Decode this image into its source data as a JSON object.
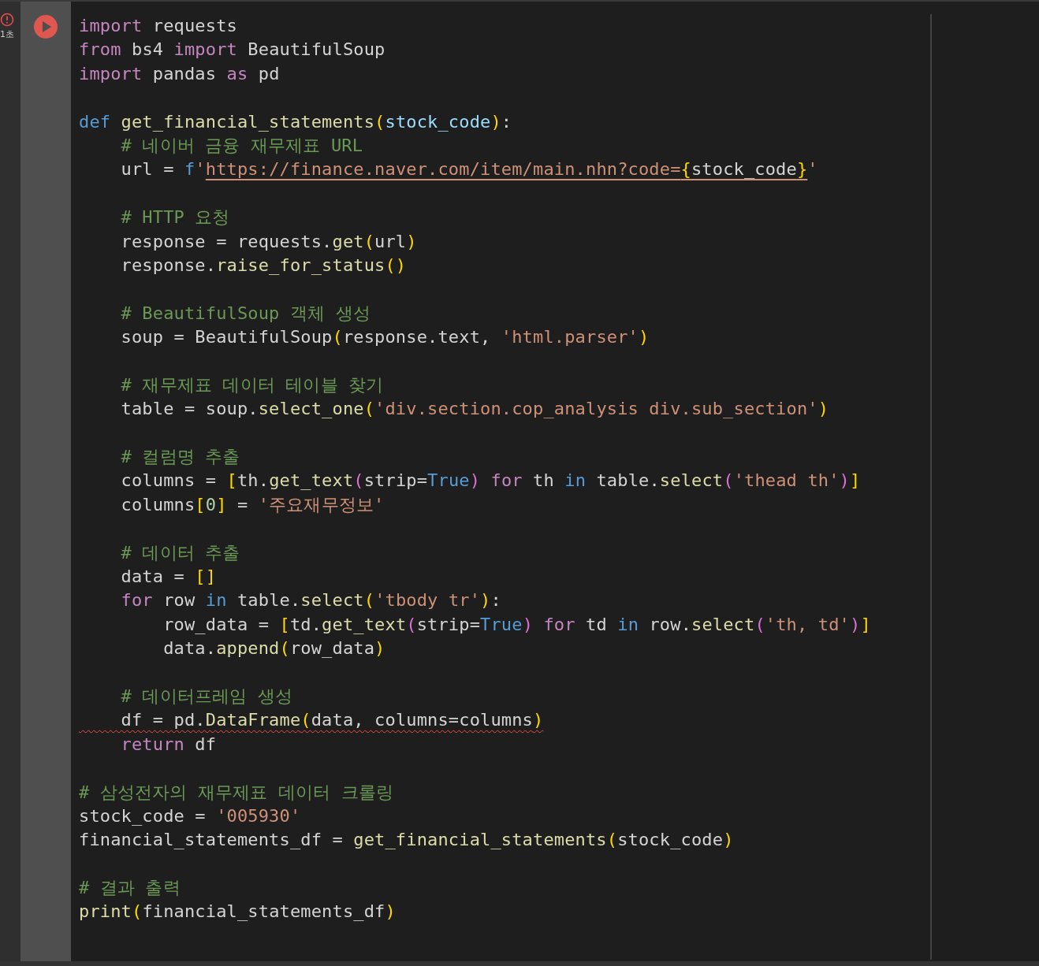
{
  "cell": {
    "status": {
      "text": "1초",
      "error": true
    },
    "run_button": {
      "failed": true
    },
    "lines": [
      {
        "kind": "code",
        "error": false,
        "tokens": [
          {
            "t": "import",
            "kind": "kw"
          },
          {
            "t": " requests",
            "kind": "plain"
          }
        ]
      },
      {
        "kind": "code",
        "error": false,
        "tokens": [
          {
            "t": "from",
            "kind": "kw"
          },
          {
            "t": " bs4 ",
            "kind": "plain"
          },
          {
            "t": "import",
            "kind": "kw"
          },
          {
            "t": " BeautifulSoup",
            "kind": "plain"
          }
        ]
      },
      {
        "kind": "code",
        "error": false,
        "tokens": [
          {
            "t": "import",
            "kind": "kw"
          },
          {
            "t": " pandas ",
            "kind": "plain"
          },
          {
            "t": "as",
            "kind": "kw"
          },
          {
            "t": " pd",
            "kind": "plain"
          }
        ]
      },
      {
        "kind": "blank"
      },
      {
        "kind": "code",
        "error": false,
        "tokens": [
          {
            "t": "def",
            "kind": "storage"
          },
          {
            "t": " get_financial_statements",
            "kind": "fn"
          },
          {
            "t": "(",
            "kind": "b1"
          },
          {
            "t": "stock_code",
            "kind": "param"
          },
          {
            "t": ")",
            "kind": "b1"
          },
          {
            "t": ":",
            "kind": "plain"
          }
        ]
      },
      {
        "kind": "code",
        "error": false,
        "tokens": [
          {
            "t": "    # 네이버 금융 재무제표 URL",
            "kind": "cmt"
          }
        ]
      },
      {
        "kind": "code",
        "error": false,
        "tokens": [
          {
            "t": "    url = ",
            "kind": "plain",
            "underlined": false
          },
          {
            "t": "f",
            "kind": "storage",
            "underlined": false
          },
          {
            "t": "'",
            "kind": "str",
            "underlined": false
          },
          {
            "t": "https://finance.naver.com/item/main.nhn?code=",
            "kind": "str",
            "underlined": true
          },
          {
            "t": "{",
            "kind": "b1",
            "underlined": true
          },
          {
            "t": "stock_code",
            "kind": "plain",
            "underlined": true
          },
          {
            "t": "}",
            "kind": "b1",
            "underlined": true
          },
          {
            "t": "'",
            "kind": "str",
            "underlined": false
          }
        ]
      },
      {
        "kind": "blank"
      },
      {
        "kind": "code",
        "error": false,
        "tokens": [
          {
            "t": "    # HTTP 요청",
            "kind": "cmt"
          }
        ]
      },
      {
        "kind": "code",
        "error": false,
        "tokens": [
          {
            "t": "    response = requests.",
            "kind": "plain"
          },
          {
            "t": "get",
            "kind": "fn"
          },
          {
            "t": "(",
            "kind": "b1"
          },
          {
            "t": "url",
            "kind": "plain"
          },
          {
            "t": ")",
            "kind": "b1"
          }
        ]
      },
      {
        "kind": "code",
        "error": false,
        "tokens": [
          {
            "t": "    response.",
            "kind": "plain"
          },
          {
            "t": "raise_for_status",
            "kind": "fn"
          },
          {
            "t": "()",
            "kind": "b1"
          }
        ]
      },
      {
        "kind": "blank"
      },
      {
        "kind": "code",
        "error": false,
        "tokens": [
          {
            "t": "    # BeautifulSoup 객체 생성",
            "kind": "cmt"
          }
        ]
      },
      {
        "kind": "code",
        "error": false,
        "tokens": [
          {
            "t": "    soup = BeautifulSoup",
            "kind": "plain"
          },
          {
            "t": "(",
            "kind": "b1"
          },
          {
            "t": "response.text, ",
            "kind": "plain"
          },
          {
            "t": "'html.parser'",
            "kind": "str"
          },
          {
            "t": ")",
            "kind": "b1"
          }
        ]
      },
      {
        "kind": "blank"
      },
      {
        "kind": "code",
        "error": false,
        "tokens": [
          {
            "t": "    # 재무제표 데이터 테이블 찾기",
            "kind": "cmt"
          }
        ]
      },
      {
        "kind": "code",
        "error": false,
        "tokens": [
          {
            "t": "    table = soup.",
            "kind": "plain"
          },
          {
            "t": "select_one",
            "kind": "fn"
          },
          {
            "t": "(",
            "kind": "b1"
          },
          {
            "t": "'div.section.cop_analysis div.sub_section'",
            "kind": "str"
          },
          {
            "t": ")",
            "kind": "b1"
          }
        ]
      },
      {
        "kind": "blank"
      },
      {
        "kind": "code",
        "error": false,
        "tokens": [
          {
            "t": "    # 컬럼명 추출",
            "kind": "cmt"
          }
        ]
      },
      {
        "kind": "code",
        "error": false,
        "tokens": [
          {
            "t": "    columns = ",
            "kind": "plain"
          },
          {
            "t": "[",
            "kind": "b1"
          },
          {
            "t": "th.",
            "kind": "plain"
          },
          {
            "t": "get_text",
            "kind": "fn"
          },
          {
            "t": "(",
            "kind": "b2"
          },
          {
            "t": "strip=",
            "kind": "plain"
          },
          {
            "t": "True",
            "kind": "const"
          },
          {
            "t": ")",
            "kind": "b2"
          },
          {
            "t": " for",
            "kind": "kw"
          },
          {
            "t": " th ",
            "kind": "plain"
          },
          {
            "t": "in",
            "kind": "op"
          },
          {
            "t": " table.",
            "kind": "plain"
          },
          {
            "t": "select",
            "kind": "fn"
          },
          {
            "t": "(",
            "kind": "b2"
          },
          {
            "t": "'thead th'",
            "kind": "str"
          },
          {
            "t": ")",
            "kind": "b2"
          },
          {
            "t": "]",
            "kind": "b1"
          }
        ]
      },
      {
        "kind": "code",
        "error": false,
        "tokens": [
          {
            "t": "    columns",
            "kind": "plain"
          },
          {
            "t": "[",
            "kind": "b1"
          },
          {
            "t": "0",
            "kind": "num"
          },
          {
            "t": "]",
            "kind": "b1"
          },
          {
            "t": " = ",
            "kind": "plain"
          },
          {
            "t": "'주요재무정보'",
            "kind": "str"
          }
        ]
      },
      {
        "kind": "blank"
      },
      {
        "kind": "code",
        "error": false,
        "tokens": [
          {
            "t": "    # 데이터 추출",
            "kind": "cmt"
          }
        ]
      },
      {
        "kind": "code",
        "error": false,
        "tokens": [
          {
            "t": "    data = ",
            "kind": "plain"
          },
          {
            "t": "[]",
            "kind": "b1"
          }
        ]
      },
      {
        "kind": "code",
        "error": false,
        "tokens": [
          {
            "t": "    for",
            "kind": "kw"
          },
          {
            "t": " row ",
            "kind": "plain"
          },
          {
            "t": "in",
            "kind": "op"
          },
          {
            "t": " table.",
            "kind": "plain"
          },
          {
            "t": "select",
            "kind": "fn"
          },
          {
            "t": "(",
            "kind": "b1"
          },
          {
            "t": "'tbody tr'",
            "kind": "str"
          },
          {
            "t": ")",
            "kind": "b1"
          },
          {
            "t": ":",
            "kind": "plain"
          }
        ]
      },
      {
        "kind": "code",
        "error": false,
        "tokens": [
          {
            "t": "        row_data = ",
            "kind": "plain"
          },
          {
            "t": "[",
            "kind": "b1"
          },
          {
            "t": "td.",
            "kind": "plain"
          },
          {
            "t": "get_text",
            "kind": "fn"
          },
          {
            "t": "(",
            "kind": "b2"
          },
          {
            "t": "strip=",
            "kind": "plain"
          },
          {
            "t": "True",
            "kind": "const"
          },
          {
            "t": ")",
            "kind": "b2"
          },
          {
            "t": " for",
            "kind": "kw"
          },
          {
            "t": " td ",
            "kind": "plain"
          },
          {
            "t": "in",
            "kind": "op"
          },
          {
            "t": " row.",
            "kind": "plain"
          },
          {
            "t": "select",
            "kind": "fn"
          },
          {
            "t": "(",
            "kind": "b2"
          },
          {
            "t": "'th, td'",
            "kind": "str"
          },
          {
            "t": ")",
            "kind": "b2"
          },
          {
            "t": "]",
            "kind": "b1"
          }
        ]
      },
      {
        "kind": "code",
        "error": false,
        "tokens": [
          {
            "t": "        data.",
            "kind": "plain"
          },
          {
            "t": "append",
            "kind": "fn"
          },
          {
            "t": "(",
            "kind": "b1"
          },
          {
            "t": "row_data",
            "kind": "plain"
          },
          {
            "t": ")",
            "kind": "b1"
          }
        ]
      },
      {
        "kind": "blank"
      },
      {
        "kind": "code",
        "error": false,
        "tokens": [
          {
            "t": "    # 데이터프레임 생성",
            "kind": "cmt"
          }
        ]
      },
      {
        "kind": "code",
        "error": true,
        "tokens": [
          {
            "t": "    df = pd.",
            "kind": "plain"
          },
          {
            "t": "DataFrame",
            "kind": "fn"
          },
          {
            "t": "(",
            "kind": "b1"
          },
          {
            "t": "data, columns=columns",
            "kind": "plain"
          },
          {
            "t": ")",
            "kind": "b1"
          }
        ]
      },
      {
        "kind": "code",
        "error": false,
        "tokens": [
          {
            "t": "    return",
            "kind": "kw"
          },
          {
            "t": " df",
            "kind": "plain"
          }
        ]
      },
      {
        "kind": "blank"
      },
      {
        "kind": "code",
        "error": false,
        "tokens": [
          {
            "t": "# 삼성전자의 재무제표 데이터 크롤링",
            "kind": "cmt"
          }
        ]
      },
      {
        "kind": "code",
        "error": false,
        "tokens": [
          {
            "t": "stock_code = ",
            "kind": "plain"
          },
          {
            "t": "'005930'",
            "kind": "str"
          }
        ]
      },
      {
        "kind": "code",
        "error": false,
        "tokens": [
          {
            "t": "financial_statements_df = ",
            "kind": "plain"
          },
          {
            "t": "get_financial_statements",
            "kind": "fn"
          },
          {
            "t": "(",
            "kind": "b1"
          },
          {
            "t": "stock_code",
            "kind": "plain"
          },
          {
            "t": ")",
            "kind": "b1"
          }
        ]
      },
      {
        "kind": "blank"
      },
      {
        "kind": "code",
        "error": false,
        "tokens": [
          {
            "t": "# 결과 출력",
            "kind": "cmt"
          }
        ]
      },
      {
        "kind": "code",
        "error": false,
        "tokens": [
          {
            "t": "print",
            "kind": "fn"
          },
          {
            "t": "(",
            "kind": "b1"
          },
          {
            "t": "financial_statements_df",
            "kind": "plain"
          },
          {
            "t": ")",
            "kind": "b1"
          }
        ]
      }
    ]
  }
}
